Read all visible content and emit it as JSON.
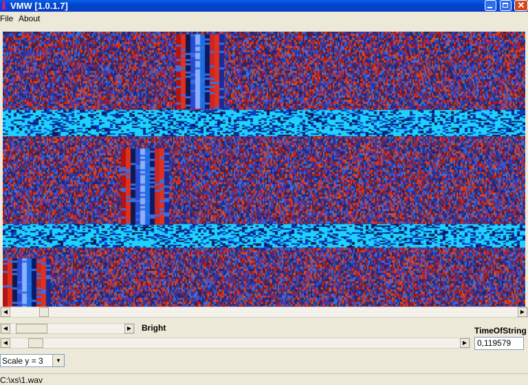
{
  "window": {
    "title": "VMW [1.0.1.7]",
    "close_glyph": "✕"
  },
  "menu": {
    "items": [
      "File",
      "About"
    ]
  },
  "controls": {
    "bright_label": "Bright",
    "time_label": "TimeOfString",
    "time_value": "0,119579",
    "scale_value": "Scale y = 3"
  },
  "status": {
    "path": "C:\\xs\\1.wav"
  },
  "icons": {
    "left_arrow": "left-arrow-icon",
    "right_arrow": "right-arrow-icon",
    "dropdown": "chevron-down-icon"
  },
  "colors": {
    "title_bar": "#0a3ec2",
    "noise_red": "#c8281e",
    "noise_blue": "#1e4ac8",
    "band_cyan": "#1ed2ff"
  }
}
